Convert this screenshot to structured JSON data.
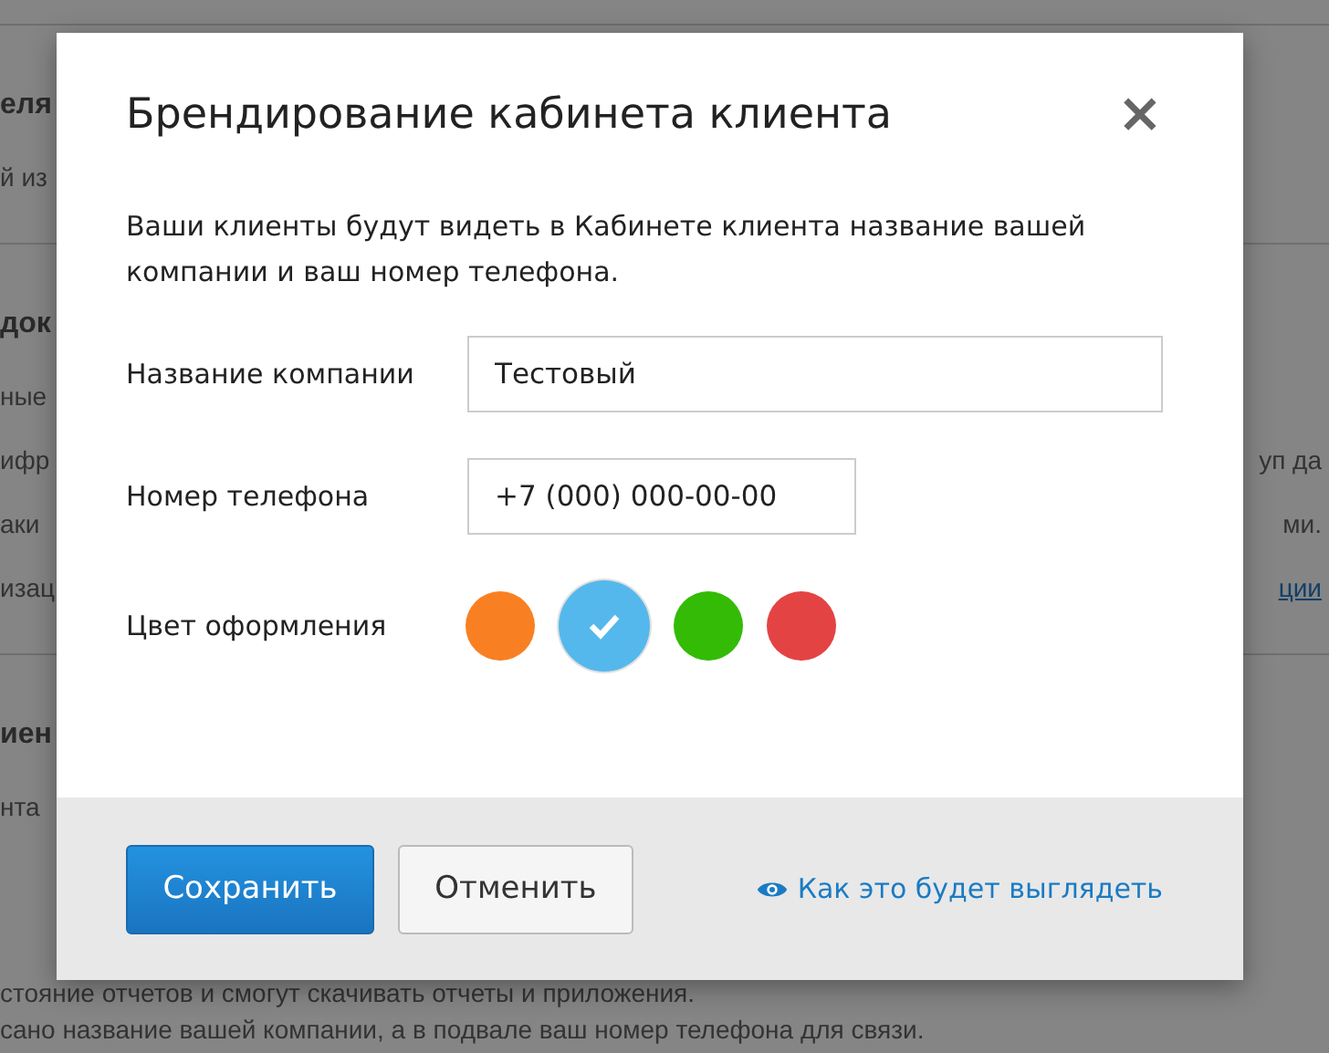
{
  "background": {
    "lines": [
      {
        "kind": "divider"
      },
      {
        "kind": "heading",
        "left": "еля"
      },
      {
        "kind": "text",
        "left": "й из"
      },
      {
        "kind": "divider"
      },
      {
        "kind": "heading",
        "left": "док"
      },
      {
        "kind": "text",
        "left": "ные"
      },
      {
        "kind": "text",
        "left": "ифр",
        "right": "уп да"
      },
      {
        "kind": "text",
        "left": "аки",
        "right": "ми."
      },
      {
        "kind": "text",
        "left": "изац",
        "right": "ции",
        "right_link": true
      },
      {
        "kind": "divider"
      },
      {
        "kind": "heading",
        "left": "иен"
      },
      {
        "kind": "text",
        "left": "нта"
      },
      {
        "kind": "text",
        "left": "стояние отчетов и смогут скачивать отчеты и приложения."
      },
      {
        "kind": "text",
        "left": "сано название вашей компании, а в подвале ваш номер телефона для связи."
      }
    ]
  },
  "dialog": {
    "title": "Брендирование кабинета клиента",
    "close": "×",
    "description": "Ваши клиенты будут видеть в Кабинете клиента название вашей компании и ваш номер телефона.",
    "fields": [
      {
        "label": "Название компании",
        "value": "Тестовый"
      },
      {
        "label": "Номер телефона",
        "value": "+7 (000) 000-00-00"
      }
    ],
    "color_label": "Цвет оформления",
    "colors": [
      {
        "color": "#f98022",
        "selected": false
      },
      {
        "color": "#55b8ec",
        "selected": true
      },
      {
        "color": "#34bb06",
        "selected": false
      },
      {
        "color": "#e44343",
        "selected": false
      }
    ],
    "buttons": [
      {
        "label": "Сохранить",
        "kind": "primary"
      },
      {
        "label": "Отменить",
        "kind": "secondary"
      }
    ],
    "preview_link": "Как это будет выглядеть"
  }
}
